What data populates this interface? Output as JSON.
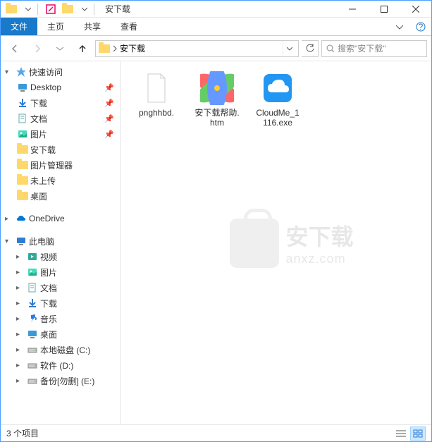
{
  "window": {
    "title": "安下载",
    "min_tooltip": "最小化",
    "max_tooltip": "最大化",
    "close_tooltip": "关闭"
  },
  "ribbon": {
    "file": "文件",
    "home": "主页",
    "share": "共享",
    "view": "查看"
  },
  "address": {
    "crumb": "安下载",
    "search_placeholder": "搜索\"安下载\""
  },
  "sidebar": {
    "quick_access": "快速访问",
    "items_pinned": [
      {
        "label": "Desktop",
        "icon": "desktop"
      },
      {
        "label": "下载",
        "icon": "downloads"
      },
      {
        "label": "文档",
        "icon": "documents"
      },
      {
        "label": "图片",
        "icon": "pictures"
      }
    ],
    "items_recent": [
      {
        "label": "安下载"
      },
      {
        "label": "图片管理器"
      },
      {
        "label": "未上传"
      },
      {
        "label": "桌面"
      }
    ],
    "onedrive": "OneDrive",
    "this_pc": "此电脑",
    "pc_items": [
      {
        "label": "视频",
        "icon": "videos"
      },
      {
        "label": "图片",
        "icon": "pictures"
      },
      {
        "label": "文档",
        "icon": "documents"
      },
      {
        "label": "下载",
        "icon": "downloads"
      },
      {
        "label": "音乐",
        "icon": "music"
      },
      {
        "label": "桌面",
        "icon": "desktop"
      }
    ],
    "drives": [
      {
        "label": "本地磁盘 (C:)"
      },
      {
        "label": "软件 (D:)"
      },
      {
        "label": "备份[勿删] (E:)"
      }
    ]
  },
  "files": [
    {
      "name": "pnghhbd.",
      "type": "file"
    },
    {
      "name": "安下载帮助.htm",
      "type": "htm"
    },
    {
      "name": "CloudMe_1116.exe",
      "type": "cloudme"
    }
  ],
  "watermark": {
    "cn": "安下载",
    "en": "anxz.com"
  },
  "status": {
    "count_text": "3 个项目"
  }
}
